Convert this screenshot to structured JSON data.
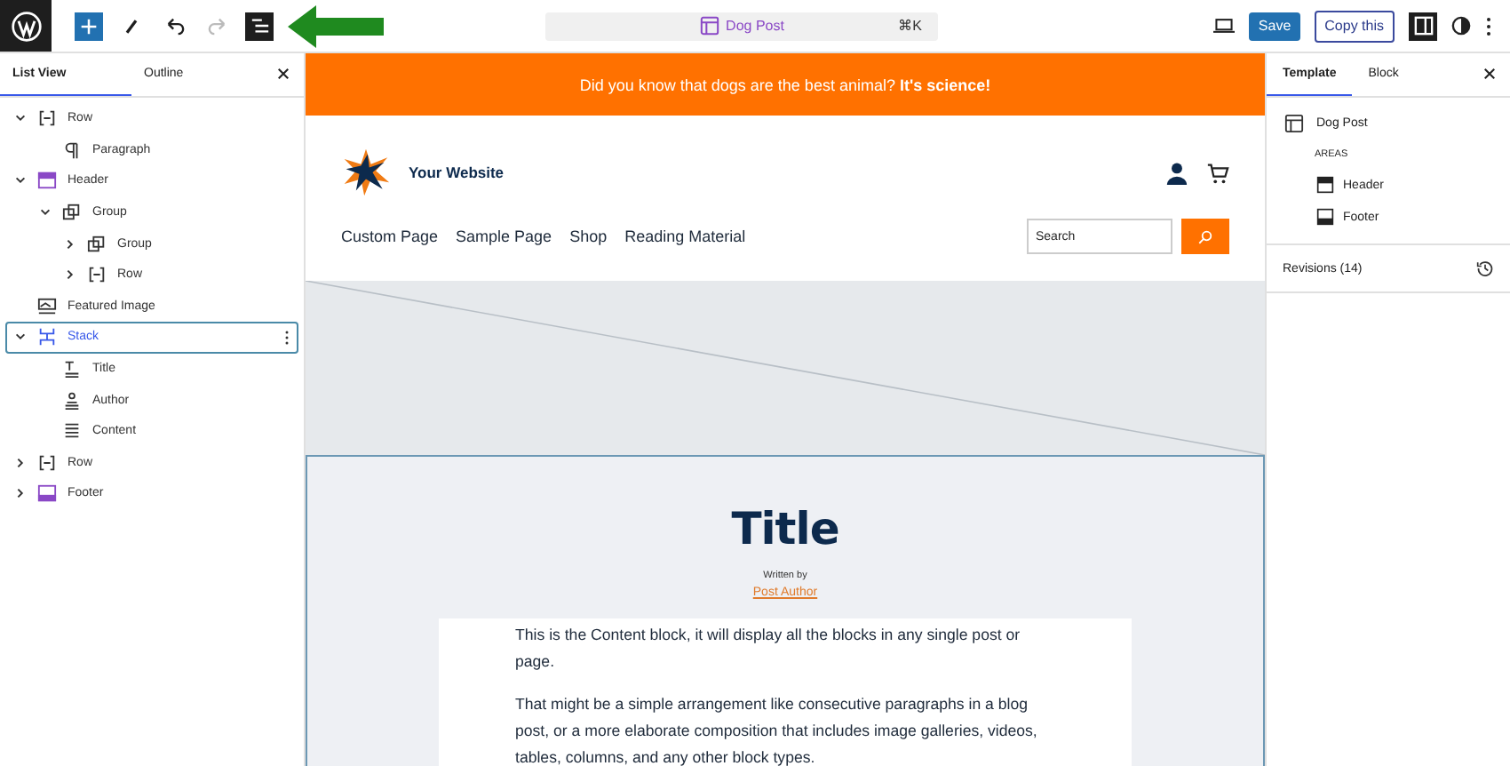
{
  "toolbar": {
    "tools": [
      {
        "kind": "add",
        "selected": false,
        "disabled": false
      },
      {
        "kind": "pen",
        "selected": false,
        "disabled": false
      },
      {
        "kind": "undo",
        "selected": false,
        "disabled": false
      },
      {
        "kind": "redo",
        "selected": false,
        "disabled": true
      },
      {
        "kind": "list-view",
        "selected": true,
        "disabled": false
      }
    ],
    "command_bar": {
      "title": "Dog Post",
      "shortcut": "⌘K"
    },
    "save_label": "Save",
    "copy_label": "Copy this"
  },
  "list_panel": {
    "tabs": [
      {
        "label": "List View",
        "selected": true
      },
      {
        "label": "Outline",
        "selected": false
      }
    ],
    "items": [
      {
        "label": "Row",
        "kind": "row",
        "expandable": true,
        "expanded": true,
        "selected": false,
        "children": [
          {
            "label": "Paragraph",
            "kind": "paragraph",
            "expandable": false,
            "selected": false
          }
        ]
      },
      {
        "label": "Header",
        "kind": "header",
        "expandable": true,
        "expanded": true,
        "selected": false,
        "children": [
          {
            "label": "Group",
            "kind": "group",
            "expandable": true,
            "expanded": true,
            "selected": false,
            "children": [
              {
                "label": "Group",
                "kind": "group",
                "expandable": true,
                "expanded": false,
                "selected": false
              },
              {
                "label": "Row",
                "kind": "row",
                "expandable": true,
                "expanded": false,
                "selected": false
              }
            ]
          }
        ]
      },
      {
        "label": "Featured Image",
        "kind": "featured-image",
        "expandable": false,
        "selected": false
      },
      {
        "label": "Stack",
        "kind": "stack",
        "expandable": true,
        "expanded": true,
        "selected": true,
        "children": [
          {
            "label": "Title",
            "kind": "title",
            "expandable": false,
            "selected": false
          },
          {
            "label": "Author",
            "kind": "author",
            "expandable": false,
            "selected": false
          },
          {
            "label": "Content",
            "kind": "content",
            "expandable": false,
            "selected": false
          }
        ]
      },
      {
        "label": "Row",
        "kind": "row",
        "expandable": true,
        "expanded": false,
        "selected": false
      },
      {
        "label": "Footer",
        "kind": "footer",
        "expandable": true,
        "expanded": false,
        "selected": false
      }
    ]
  },
  "canvas": {
    "banner": "Did you know that dogs are the best animal? **It's science!**",
    "site_title": "Your Website",
    "nav": [
      "Custom Page",
      "Sample Page",
      "Shop",
      "Reading Material"
    ],
    "search": {
      "placeholder": "Search"
    },
    "post": {
      "title": "Title",
      "byline": "Written by",
      "author": "Post Author",
      "paragraphs": [
        "This is the Content block, it will display all the blocks in any single post or page.",
        "That might be a simple arrangement like consecutive paragraphs in a blog post, or a more elaborate composition that includes image galleries, videos, tables, columns, and any other block types."
      ]
    }
  },
  "settings_panel": {
    "tabs": [
      {
        "label": "Template",
        "selected": true
      },
      {
        "label": "Block",
        "selected": false
      }
    ],
    "template_name": "Dog Post",
    "areas_heading": "AREAS",
    "areas": [
      {
        "label": "Header",
        "kind": "header"
      },
      {
        "label": "Footer",
        "kind": "footer"
      }
    ],
    "revisions": "Revisions (14)"
  }
}
